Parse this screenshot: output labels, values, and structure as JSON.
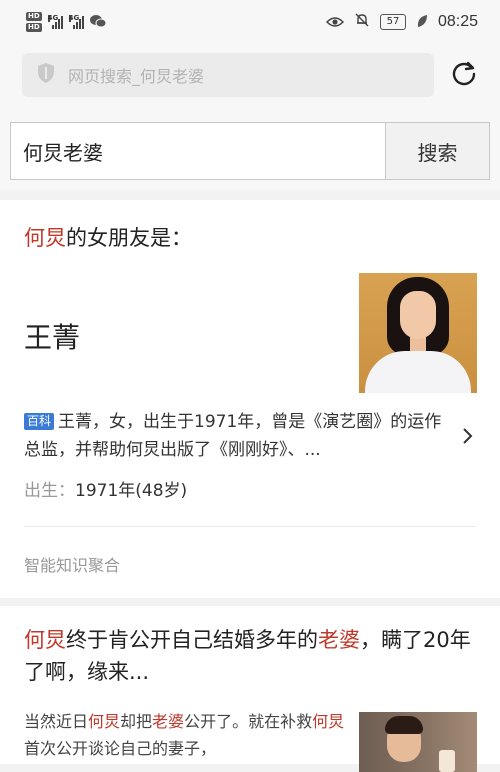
{
  "status_bar": {
    "sim1": "HD",
    "sim2": "HD",
    "net1": "4G",
    "net2": "4G",
    "battery": "57",
    "time": "08:25",
    "icons": [
      "eye-icon",
      "mute-bell-icon",
      "battery-icon",
      "leaf-icon",
      "wechat-icon"
    ]
  },
  "browser": {
    "url_placeholder": "网页搜索_何炅老婆"
  },
  "search": {
    "query": "何炅老婆",
    "button_label": "搜索"
  },
  "knowledge_card": {
    "question_highlight": "何炅",
    "question_rest": "的女朋友是：",
    "answer": "王菁",
    "source_tag": "百科",
    "description": "王菁，女，出生于1971年，曾是《演艺圈》的运作总监，并帮助何炅出版了《刚刚好》、...",
    "birth_label": "出生：",
    "birth_value": "1971年(48岁)",
    "source_label": "智能知识聚合"
  },
  "news_result": {
    "title_part1": "何炅",
    "title_part2": "终于肯公开自己结婚多年的",
    "title_part3": "老婆",
    "title_part4": "，瞒了20年了啊，缘来...",
    "snippet_part1": "当然近日",
    "snippet_part2": "何炅",
    "snippet_part3": "却把",
    "snippet_part4": "老婆",
    "snippet_part5": "公开了。就在补救",
    "snippet_part6": "何炅",
    "snippet_part7": "首次公开谈论自己的妻子，"
  }
}
